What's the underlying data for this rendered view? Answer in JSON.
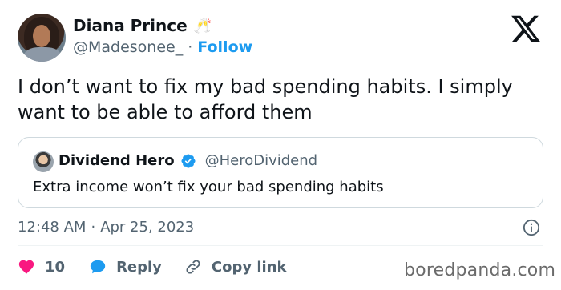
{
  "author": {
    "display_name": "Diana Prince",
    "badge_icon": "champagne-cheers-icon",
    "handle": "@Madesonee_",
    "separator": "·",
    "follow_label": "Follow"
  },
  "tweet": {
    "text": "I don’t want to fix my bad spending habits. I simply want to be able to afford them"
  },
  "quoted_tweet": {
    "display_name": "Dividend Hero",
    "verified_icon": "verified-badge-icon",
    "handle": "@HeroDividend",
    "text": "Extra income won’t fix your bad spending habits"
  },
  "meta": {
    "time": "12:48 AM",
    "separator": "·",
    "date": "Apr 25, 2023"
  },
  "actions": {
    "like_count": "10",
    "reply_label": "Reply",
    "copy_link_label": "Copy link"
  },
  "watermark": "boredpanda.com",
  "colors": {
    "accent": "#1d9bf0",
    "like": "#f91880",
    "text": "#0f1419",
    "muted": "#536471"
  }
}
